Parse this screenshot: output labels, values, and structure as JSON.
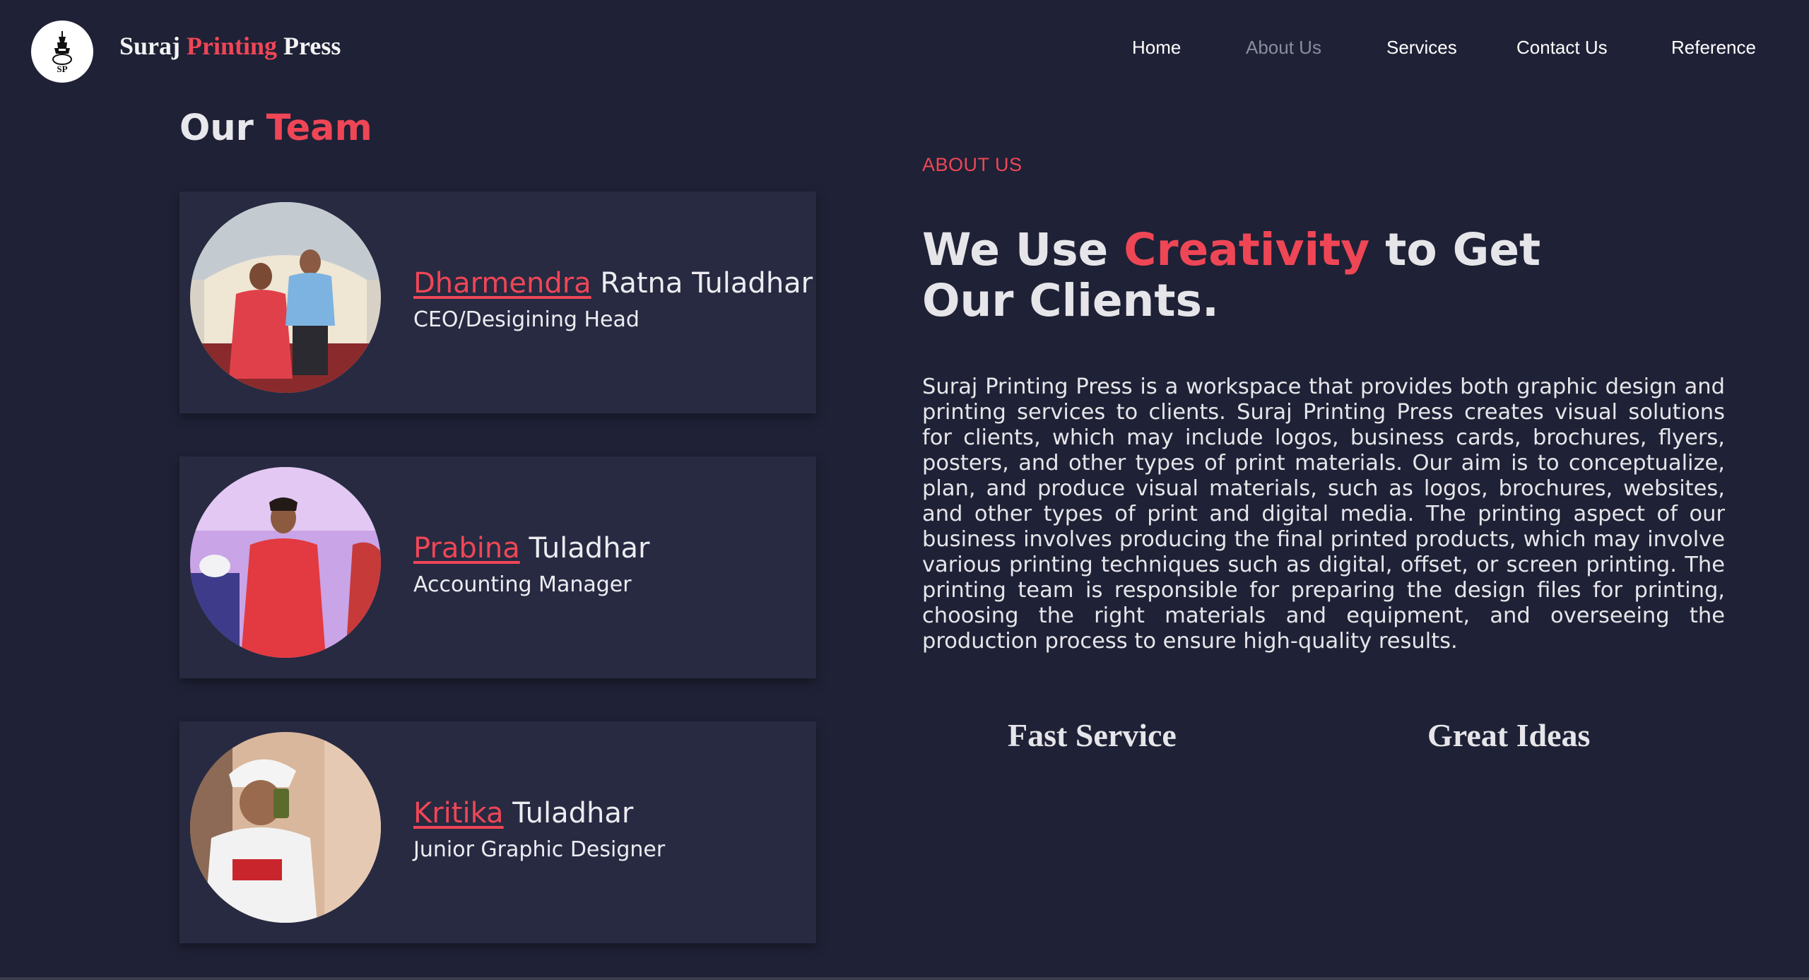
{
  "header": {
    "brand_part1": "Suraj ",
    "brand_part2": "Printing",
    "brand_part3": " Press",
    "nav": [
      {
        "label": "Home"
      },
      {
        "label": "About Us"
      },
      {
        "label": "Services"
      },
      {
        "label": "Contact Us"
      },
      {
        "label": "Reference"
      }
    ]
  },
  "team": {
    "title_part1": "Our ",
    "title_part2": "Team",
    "members": [
      {
        "first": "Dharmendra",
        "rest": " Ratna Tuladhar",
        "role": "CEO/Desigining Head"
      },
      {
        "first": "Prabina",
        "rest": " Tuladhar",
        "role": "Accounting Manager"
      },
      {
        "first": "Kritika",
        "rest": " Tuladhar",
        "role": "Junior Graphic Designer"
      }
    ]
  },
  "about": {
    "label": "ABOUT US",
    "headline_part1": "We Use ",
    "headline_part2": "Creativity",
    "headline_part3": " to Get Our Clients.",
    "paragraph": "Suraj Printing Press is a workspace that provides both graphic design and printing services to clients. Suraj Printing Press creates visual solutions for clients, which may include logos, business cards, brochures, flyers, posters, and other types of print materials. Our aim is to conceptualize, plan, and produce visual materials, such as logos, brochures, websites, and other types of print and digital media. The printing aspect of our business involves producing the final printed products, which may involve various printing techniques such as digital, offset, or screen printing. The printing team is responsible for preparing the design files for printing, choosing the right materials and equipment, and overseeing the production process to ensure high-quality results.",
    "features": [
      {
        "label": "Fast Service"
      },
      {
        "label": "Great Ideas"
      }
    ]
  },
  "colors": {
    "background": "#1f2136",
    "card": "#272a41",
    "accent": "#ef4656",
    "nav_active": "#8b8d9e"
  },
  "icons": {
    "logo": "stupa-logo-icon"
  }
}
